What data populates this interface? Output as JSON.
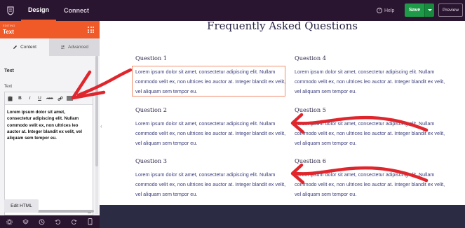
{
  "topbar": {
    "tabs": [
      {
        "label": "Design"
      },
      {
        "label": "Connect"
      }
    ],
    "help_label": "Help",
    "save_label": "Save",
    "preview_label": "Preview"
  },
  "panel": {
    "editing_label": "EDITING",
    "editing_title": "Text",
    "subtabs": [
      {
        "label": "Content"
      },
      {
        "label": "Advanced"
      }
    ],
    "section_title": "Text",
    "field_label": "Text",
    "toolbar": {
      "bold": "B",
      "italic": "I",
      "underline": "U",
      "strike": "ABC"
    },
    "editor_text": "Lorem ipsum dolor sit amet, consectetur adipiscing elit. Nullam commodo velit ex, non ultrices leo auctor at. Integer blandit ex velit, vel aliquam sem tempor eu.",
    "edit_html_label": "Edit HTML"
  },
  "page": {
    "title": "Frequently Asked Questions",
    "faqs": [
      {
        "question": "Question 1",
        "answer": "Lorem ipsum dolor sit amet, consectetur adipiscing elit. Nullam commodo velit ex, non ultrices leo auctor at. Integer blandit ex velit, vel aliquam sem tempor eu."
      },
      {
        "question": "Question 4",
        "answer": "Lorem ipsum dolor sit amet, consectetur adipiscing elit. Nullam commodo velit ex, non ultrices leo auctor at. Integer blandit ex velit, vel aliquam sem tempor eu."
      },
      {
        "question": "Question 2",
        "answer": "Lorem ipsum dolor sit amet, consectetur adipiscing elit. Nullam commodo velit ex, non ultrices leo auctor at. Integer blandit ex velit, vel aliquam sem tempor eu."
      },
      {
        "question": "Question 5",
        "answer": "Lorem ipsum dolor sit amet, consectetur adipiscing elit. Nullam commodo velit ex, non ultrices leo auctor at. Integer blandit ex velit, vel aliquam sem tempor eu."
      },
      {
        "question": "Question 3",
        "answer": "Lorem ipsum dolor sit amet, consectetur adipiscing elit. Nullam commodo velit ex, non ultrices leo auctor at. Integer blandit ex velit, vel aliquam sem tempor eu."
      },
      {
        "question": "Question 6",
        "answer": "Lorem ipsum dolor sit amet, consectetur adipiscing elit. Nullam commodo velit ex, non ultrices leo auctor at. Integer blandit ex velit, vel aliquam sem tempor eu."
      }
    ]
  },
  "colors": {
    "topbar": "#2a1530",
    "accent": "#f05a28",
    "save": "#1e9a48",
    "heading": "#2d2648",
    "body_text": "#3c3f7c",
    "annotation": "#e0262d"
  },
  "icons": [
    "logo-icon",
    "help-icon",
    "chevron-down-icon",
    "grid-dots-icon",
    "pencil-icon",
    "sliders-icon",
    "paste-icon",
    "link-icon",
    "kitchen-sink-icon",
    "settings-icon",
    "layers-icon",
    "history-icon",
    "undo-icon",
    "redo-icon",
    "mobile-icon",
    "chevron-left-icon",
    "arrow-annotation-icon"
  ]
}
